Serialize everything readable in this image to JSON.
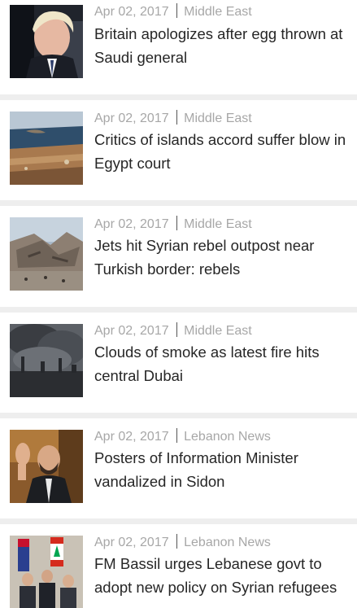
{
  "articles": [
    {
      "date": "Apr 02, 2017",
      "category": "Middle East",
      "title": "Britain apologizes after egg thrown at Saudi general",
      "image": "portrait-man-blond-hair"
    },
    {
      "date": "Apr 02, 2017",
      "category": "Middle East",
      "title": "Critics of islands accord suffer blow in Egypt court",
      "image": "aerial-coastline-islands"
    },
    {
      "date": "Apr 02, 2017",
      "category": "Middle East",
      "title": "Jets hit Syrian rebel outpost near Turkish border: rebels",
      "image": "destroyed-building-rubble"
    },
    {
      "date": "Apr 02, 2017",
      "category": "Middle East",
      "title": "Clouds of smoke as latest fire hits central Dubai",
      "image": "smoke-over-city-skyline"
    },
    {
      "date": "Apr 02, 2017",
      "category": "Lebanon News",
      "title": "Posters of Information Minister vandalized in Sidon",
      "image": "man-waving-hand"
    },
    {
      "date": "Apr 02, 2017",
      "category": "Lebanon News",
      "title": "FM Bassil urges Lebanese govt to adopt new policy on Syrian refugees",
      "image": "officials-seated-with-flags"
    }
  ]
}
